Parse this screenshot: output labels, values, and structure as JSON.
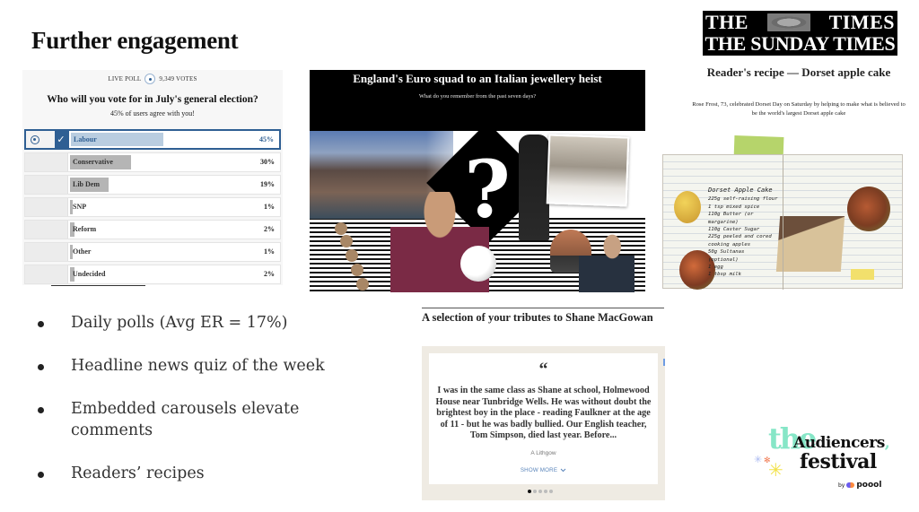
{
  "slide": {
    "title": "Further engagement"
  },
  "poll": {
    "live_label": "LIVE POLL",
    "votes": "9,349 VOTES",
    "question": "Who will you vote for in July's general election?",
    "agree_text": "45% of users agree with you!",
    "selected_index": 0,
    "options": [
      {
        "label": "Labour",
        "percent": 45,
        "percent_text": "45%"
      },
      {
        "label": "Conservative",
        "percent": 30,
        "percent_text": "30%"
      },
      {
        "label": "Lib Dem",
        "percent": 19,
        "percent_text": "19%"
      },
      {
        "label": "SNP",
        "percent": 1,
        "percent_text": "1%"
      },
      {
        "label": "Reform",
        "percent": 2,
        "percent_text": "2%"
      },
      {
        "label": "Other",
        "percent": 1,
        "percent_text": "1%"
      },
      {
        "label": "Undecided",
        "percent": 2,
        "percent_text": "2%"
      }
    ],
    "colors": {
      "accent": "#2f5f93",
      "selected_bar": "#b9cde0",
      "bar": "#b5b5b5"
    }
  },
  "quiz": {
    "title": "England's Euro squad to an Italian jewellery heist",
    "subtitle": "What do you remember from the past seven days?",
    "question_glyph": "?"
  },
  "recipe": {
    "logo_line1_left": "THE",
    "logo_line1_right": "TIMES",
    "logo_line2": "THE SUNDAY TIMES",
    "title": "Reader's recipe — Dorset apple cake",
    "subtitle": "Rose Frost, 73, celebrated Dorset Day on Saturday by helping to make what is believed to be the world's largest Dorset apple cake",
    "handwriting_title": "Dorset Apple Cake",
    "handwriting_lines": [
      "225g self-raising flour",
      "1 tsp mixed spice",
      "110g Butter (or margarine)",
      "110g Caster Sugar",
      "225g peeled and cored",
      "cooking apples",
      "50g Sultanas",
      "(optional)",
      "1 egg",
      "1 tbsp milk"
    ]
  },
  "bullets": [
    "Daily polls (Avg ER = 17%)",
    "Headline news quiz of the week",
    "Embedded carousels elevate comments",
    "Readers’ recipes"
  ],
  "tributes": {
    "title": "A selection of your tributes to Shane MacGowan",
    "quote_mark": "“",
    "quote": "I was in the same class as Shane at school, Holmewood House near Tunbridge Wells. He was without doubt the brightest boy in the place - reading Faulkner at the age of 11 - but he was badly bullied. Our English teacher, Tom Simpson, died last year. Before...",
    "author": "A Lithgow",
    "show_more": "SHOW MORE",
    "page_count": 5,
    "active_page": 1
  },
  "festival_logo": {
    "the": "the",
    "audiencers": "Audiencers",
    "comma": ",",
    "festival": "festival",
    "by": "by",
    "brand": "poool"
  }
}
